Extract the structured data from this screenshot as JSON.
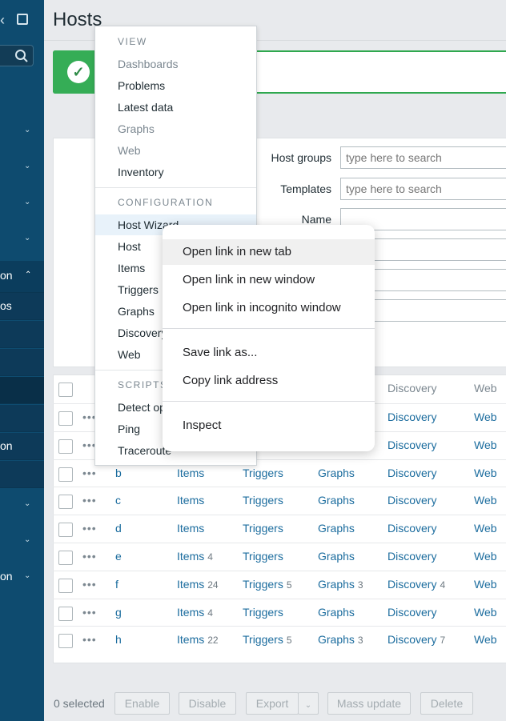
{
  "header": {
    "title": "Hosts"
  },
  "sidebar": {
    "items_partial": [
      {
        "label": "on"
      },
      {
        "label": "os"
      },
      {
        "label": "on"
      },
      {
        "label": "on"
      }
    ]
  },
  "filter": {
    "host_groups_label": "Host groups",
    "host_groups_placeholder": "type here to search",
    "templates_label": "Templates",
    "templates_placeholder": "type here to search",
    "name_label": "Name"
  },
  "table": {
    "columns": {
      "discovery": "Discovery",
      "web": "Web"
    },
    "rows": [
      {
        "name": "",
        "items": "",
        "items_count": "",
        "triggers": "",
        "triggers_count": "",
        "graphs": "",
        "graphs_count": "",
        "discovery": "Discovery",
        "discovery_count": "",
        "web": "Web"
      },
      {
        "name": "",
        "items": "",
        "items_count": "",
        "triggers": "",
        "triggers_count": "",
        "graphs": "",
        "graphs_count": "",
        "discovery": "Discovery",
        "discovery_count": "",
        "web": "Web"
      },
      {
        "name": "b",
        "items": "Items",
        "items_count": "",
        "triggers": "Triggers",
        "triggers_count": "",
        "graphs": "Graphs",
        "graphs_count": "",
        "discovery": "Discovery",
        "discovery_count": "",
        "web": "Web"
      },
      {
        "name": "c",
        "items": "Items",
        "items_count": "",
        "triggers": "Triggers",
        "triggers_count": "",
        "graphs": "Graphs",
        "graphs_count": "",
        "discovery": "Discovery",
        "discovery_count": "",
        "web": "Web"
      },
      {
        "name": "d",
        "items": "Items",
        "items_count": "",
        "triggers": "Triggers",
        "triggers_count": "",
        "graphs": "Graphs",
        "graphs_count": "",
        "discovery": "Discovery",
        "discovery_count": "",
        "web": "Web"
      },
      {
        "name": "e",
        "items": "Items",
        "items_count": "4",
        "triggers": "Triggers",
        "triggers_count": "",
        "graphs": "Graphs",
        "graphs_count": "",
        "discovery": "Discovery",
        "discovery_count": "",
        "web": "Web"
      },
      {
        "name": "f",
        "items": "Items",
        "items_count": "24",
        "triggers": "Triggers",
        "triggers_count": "5",
        "graphs": "Graphs",
        "graphs_count": "3",
        "discovery": "Discovery",
        "discovery_count": "4",
        "web": "Web"
      },
      {
        "name": "g",
        "items": "Items",
        "items_count": "4",
        "triggers": "Triggers",
        "triggers_count": "",
        "graphs": "Graphs",
        "graphs_count": "",
        "discovery": "Discovery",
        "discovery_count": "",
        "web": "Web"
      },
      {
        "name": "h",
        "items": "Items",
        "items_count": "22",
        "triggers": "Triggers",
        "triggers_count": "5",
        "graphs": "Graphs",
        "graphs_count": "3",
        "discovery": "Discovery",
        "discovery_count": "7",
        "web": "Web"
      }
    ]
  },
  "footer": {
    "selected": "0 selected",
    "enable": "Enable",
    "disable": "Disable",
    "export": "Export",
    "mass_update": "Mass update",
    "delete": "Delete"
  },
  "host_menu": {
    "view_header": "VIEW",
    "view_items": [
      "Dashboards",
      "Problems",
      "Latest data",
      "Graphs",
      "Web",
      "Inventory"
    ],
    "config_header": "CONFIGURATION",
    "config_items": [
      "Host Wizard",
      "Host",
      "Items",
      "Triggers",
      "Graphs",
      "Discovery",
      "Web"
    ],
    "scripts_header": "SCRIPTS",
    "scripts_items": [
      "Detect op",
      "Ping",
      "Traceroute"
    ]
  },
  "context_menu": {
    "items": [
      "Open link in new tab",
      "Open link in new window",
      "Open link in incognito window",
      "Save link as...",
      "Copy link address",
      "Inspect"
    ]
  },
  "colors": {
    "sidebar": "#0e4b6f",
    "link": "#1b6c9e",
    "success": "#35ad56"
  }
}
